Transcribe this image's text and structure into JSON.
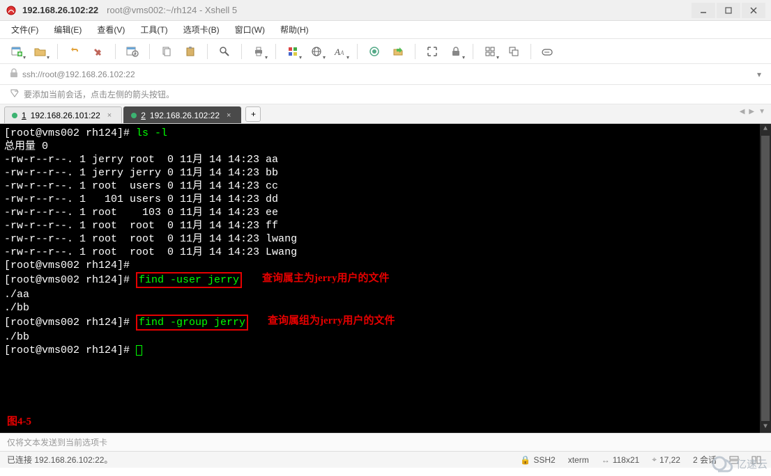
{
  "window": {
    "title_main": "192.168.26.102:22",
    "title_sub": "root@vms002:~/rh124 - Xshell 5"
  },
  "menu": {
    "file": "文件(F)",
    "edit": "编辑(E)",
    "view": "查看(V)",
    "tools": "工具(T)",
    "tab": "选项卡(B)",
    "window": "窗口(W)",
    "help": "帮助(H)"
  },
  "toolbar_icons": {
    "new": "new-session-icon",
    "open": "open-icon",
    "reconnect": "reconnect-icon",
    "disconnect": "disconnect-icon",
    "properties": "properties-icon",
    "copy": "copy-icon",
    "paste": "paste-icon",
    "find": "find-icon",
    "print": "print-icon",
    "color": "color-scheme-icon",
    "encoding": "encoding-icon",
    "font": "font-icon",
    "xagent": "xagent-icon",
    "xftp": "xftp-icon",
    "fullscreen": "fullscreen-icon",
    "lock": "lock-icon",
    "tile": "tile-icon",
    "cascade": "cascade-icon",
    "compose": "compose-icon"
  },
  "address": {
    "url": "ssh://root@192.168.26.102:22"
  },
  "hint": {
    "text": "要添加当前会话，点击左侧的箭头按钮。"
  },
  "tabs": {
    "t1_num": "1",
    "t1_label": "192.168.26.101:22",
    "t2_num": "2",
    "t2_label": "192.168.26.102:22",
    "add": "+"
  },
  "terminal": {
    "prompt": "[root@vms002 rh124]# ",
    "cmd_ls": "ls -l",
    "total": "总用量 0",
    "l1": "-rw-r--r--. 1 jerry root  0 11月 14 14:23 aa",
    "l2": "-rw-r--r--. 1 jerry jerry 0 11月 14 14:23 bb",
    "l3": "-rw-r--r--. 1 root  users 0 11月 14 14:23 cc",
    "l4": "-rw-r--r--. 1   101 users 0 11月 14 14:23 dd",
    "l5": "-rw-r--r--. 1 root    103 0 11月 14 14:23 ee",
    "l6": "-rw-r--r--. 1 root  root  0 11月 14 14:23 ff",
    "l7": "-rw-r--r--. 1 root  root  0 11月 14 14:23 lwang",
    "l8": "-rw-r--r--. 1 root  root  0 11月 14 14:23 Lwang",
    "cmd_find_user": "find -user jerry",
    "anno_user": "查询属主为jerry用户的文件",
    "res_aa": "./aa",
    "res_bb": "./bb",
    "cmd_find_group": "find -group jerry",
    "anno_group": "查询属组为jerry用户的文件",
    "fig": "图4-5"
  },
  "inputbar": {
    "placeholder": "仅将文本发送到当前选项卡"
  },
  "status": {
    "conn": "已连接 192.168.26.102:22。",
    "proto": "SSH2",
    "term": "xterm",
    "size": "118x21",
    "pos": "17,22",
    "sessions": "2 会话"
  },
  "watermark": "亿速云"
}
